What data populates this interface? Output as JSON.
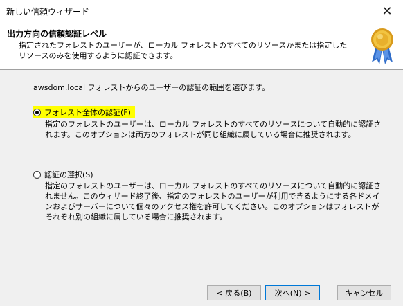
{
  "window": {
    "title": "新しい信頼ウィザード",
    "close_icon": "close-icon"
  },
  "header": {
    "heading": "出力方向の信頼認証レベル",
    "subheading": "指定されたフォレストのユーザーが、ローカル フォレストのすべてのリソースかまたは指定したリソースのみを使用するように認証できます。",
    "icon": "certificate-ribbon-icon"
  },
  "main": {
    "intro": "awsdom.local フォレストからのユーザーの認証の範囲を選びます。",
    "options": [
      {
        "label": "フォレスト全体の認証(F)",
        "description": "指定のフォレストのユーザーは、ローカル フォレストのすべてのリソースについて自動的に認証されます。このオプションは両方のフォレストが同じ組織に属している場合に推奨されます。",
        "selected": true
      },
      {
        "label": "認証の選択(S)",
        "description": "指定のフォレストのユーザーは、ローカル フォレストのすべてのリソースについて自動的に認証されません。このウィザード終了後、指定のフォレストのユーザーが利用できるようにする各ドメインおよびサーバーについて個々のアクセス権を許可してください。このオプションはフォレストがそれぞれ別の組織に属している場合に推奨されます。",
        "selected": false
      }
    ]
  },
  "footer": {
    "back_label": "< 戻る(B)",
    "next_label": "次へ(N) >",
    "cancel_label": "キャンセル"
  },
  "colors": {
    "highlight": "#ffff00",
    "default_button_border": "#0078d7"
  }
}
